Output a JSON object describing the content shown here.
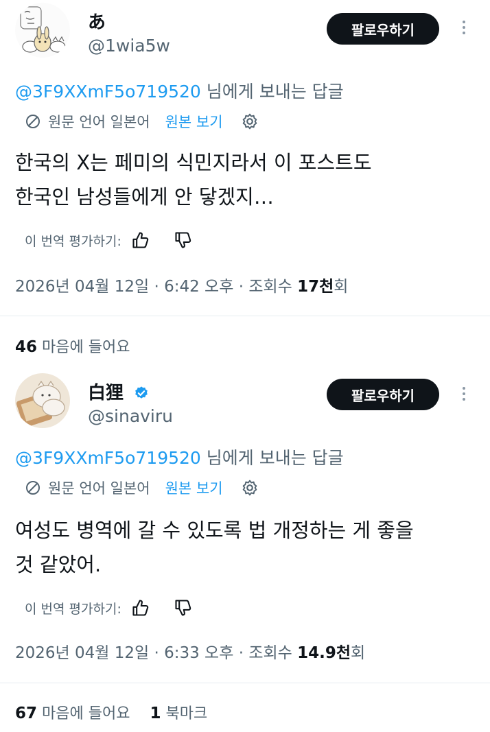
{
  "posts": [
    {
      "name": "あ",
      "handle": "@1wia5w",
      "follow_label": "팔로우하기",
      "reply_mention": "@3F9XXmF5o719520",
      "reply_suffix": " 님에게 보내는 답글",
      "translate_label": "원문 언어 일본어",
      "view_original": "원본 보기",
      "body_lines": [
        "한국의 X는 페미의 식민지라서 이 포스트도",
        "한국인 남성들에게 안 닿겠지…"
      ],
      "rate_label": "이 번역 평가하기:",
      "date": "2026년 04월 12일 · 6:42 오후 · 조회수 ",
      "views_bold": "17천",
      "views_suffix": "회",
      "likes_count": "46",
      "likes_label": " 마음에 들어요"
    },
    {
      "name": "白狸",
      "handle": "@sinaviru",
      "follow_label": "팔로우하기",
      "reply_mention": "@3F9XXmF5o719520",
      "reply_suffix": " 님에게 보내는 답글",
      "translate_label": "원문 언어 일본어",
      "view_original": "원본 보기",
      "body_lines": [
        "여성도 병역에 갈 수 있도록 법 개정하는 게 좋을",
        "것 같았어."
      ],
      "rate_label": "이 번역 평가하기:",
      "date": "2026년 04월 12일 · 6:33 오후 · 조회수 ",
      "views_bold": "14.9천",
      "views_suffix": "회",
      "likes_count": "67",
      "likes_label": " 마음에 들어요",
      "bookmarks_count": "1",
      "bookmarks_label": " 북마크"
    }
  ],
  "colors": {
    "accent": "#1d9bf0",
    "text": "#0f1419",
    "muted": "#536471",
    "button": "#0f1419"
  }
}
